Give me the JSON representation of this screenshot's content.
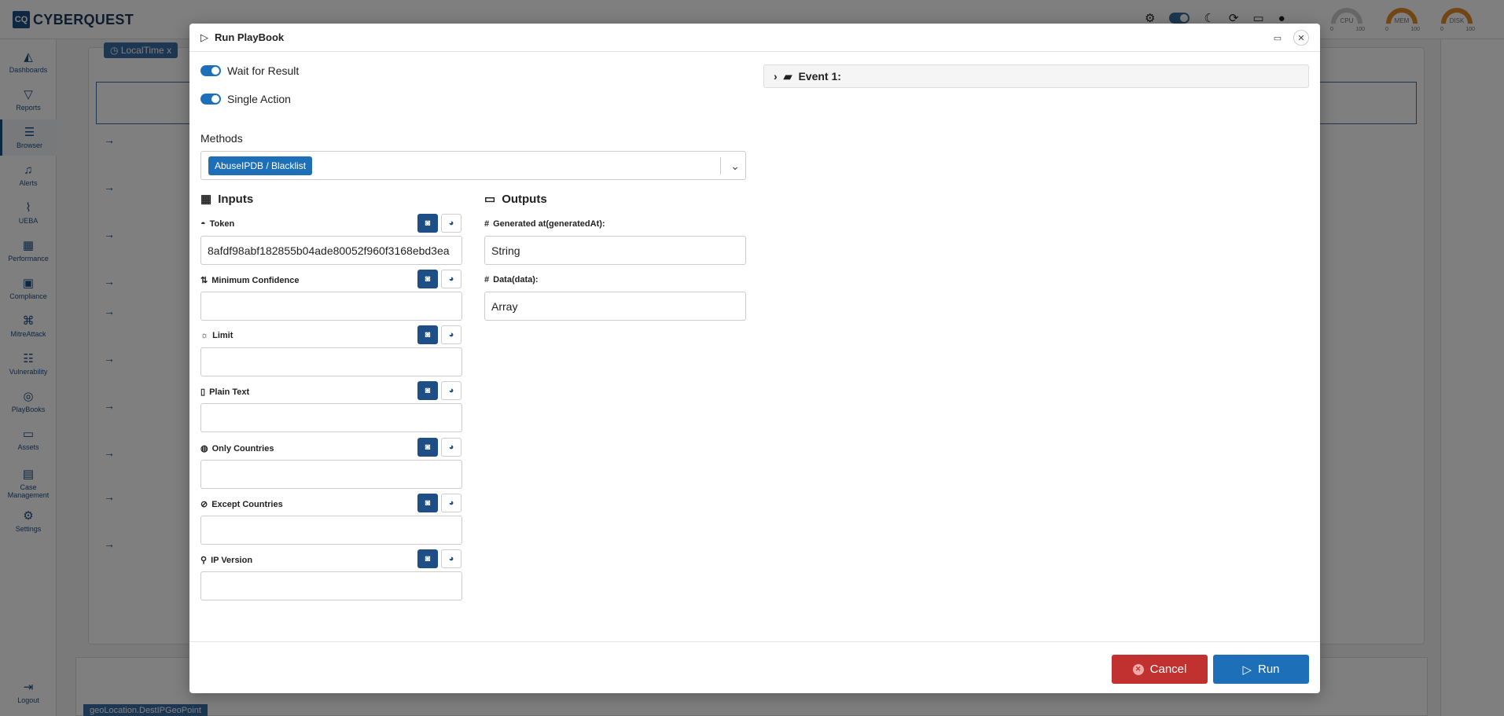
{
  "app": {
    "logo_mark": "CQ",
    "logo_text": "CYBERQUEST"
  },
  "topbar": {
    "icons": [
      "gear-icon",
      "theme-toggle",
      "moon-icon",
      "refresh-icon",
      "monitor-icon",
      "user-icon"
    ],
    "gauges": [
      {
        "label": "CPU",
        "min": "0",
        "max": "100"
      },
      {
        "label": "MEM",
        "min": "0",
        "max": "100"
      },
      {
        "label": "DISK",
        "min": "0",
        "max": "100"
      }
    ]
  },
  "sidebar": {
    "items": [
      {
        "label": "Dashboards",
        "icon": "chart-area-icon"
      },
      {
        "label": "Reports",
        "icon": "filter-icon"
      },
      {
        "label": "Browser",
        "icon": "list-icon"
      },
      {
        "label": "Alerts",
        "icon": "bell-icon"
      },
      {
        "label": "UEBA",
        "icon": "line-chart-icon"
      },
      {
        "label": "Performance",
        "icon": "keyboard-icon"
      },
      {
        "label": "Compliance",
        "icon": "compliance-icon"
      },
      {
        "label": "MitreAttack",
        "icon": "command-icon"
      },
      {
        "label": "Vulnerability",
        "icon": "server-icon"
      },
      {
        "label": "PlayBooks",
        "icon": "circles-icon"
      },
      {
        "label": "Assets",
        "icon": "laptop-icon"
      },
      {
        "label": "Case Management",
        "icon": "briefcase-icon"
      },
      {
        "label": "Settings",
        "icon": "settings-icon"
      }
    ],
    "logout": "Logout"
  },
  "background": {
    "tag": "LocalTime",
    "tag_close": "x",
    "bottom_tag": "geoLocation.DestIPGeoPoint"
  },
  "modal": {
    "title": "Run PlayBook",
    "wait_for_result": "Wait for Result",
    "single_action": "Single Action",
    "methods_label": "Methods",
    "method_selected": "AbuseIPDB / Blacklist",
    "inputs_title": "Inputs",
    "outputs_title": "Outputs",
    "inputs": [
      {
        "label": "Token",
        "value": "8afdf98abf182855b04ade80052f960f3168ebd3ea",
        "icon": "user-secret-icon"
      },
      {
        "label": "Minimum Confidence",
        "value": "",
        "icon": "sort-icon"
      },
      {
        "label": "Limit",
        "value": "",
        "icon": "sun-icon"
      },
      {
        "label": "Plain Text",
        "value": "",
        "icon": "file-icon"
      },
      {
        "label": "Only Countries",
        "value": "",
        "icon": "globe-icon"
      },
      {
        "label": "Except Countries",
        "value": "",
        "icon": "ban-globe-icon"
      },
      {
        "label": "IP Version",
        "value": "",
        "icon": "map-pin-icon"
      }
    ],
    "outputs": [
      {
        "label": "Generated at(generatedAt):",
        "value": "String"
      },
      {
        "label": "Data(data):",
        "value": "Array"
      }
    ],
    "event_label": "Event 1:",
    "cancel_label": "Cancel",
    "run_label": "Run"
  }
}
